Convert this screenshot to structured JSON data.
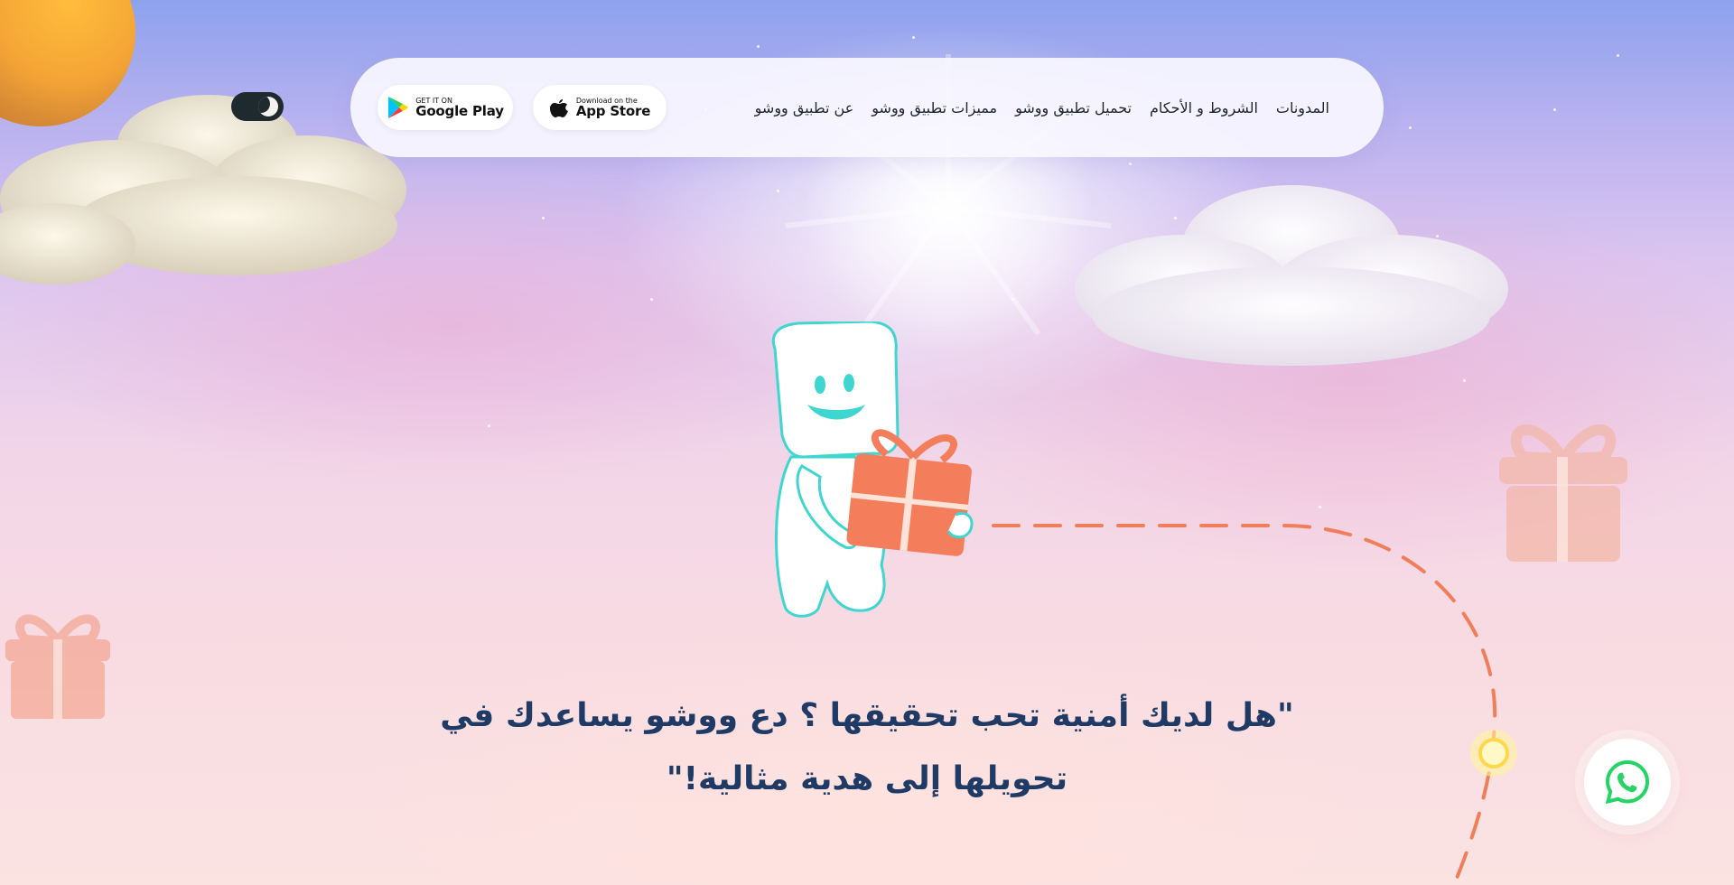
{
  "nav": {
    "links": [
      "عن تطبيق ووشو",
      "مميزات تطبيق ووشو",
      "تحميل تطبيق ووشو",
      "الشروط و الأحكام",
      "المدونات"
    ],
    "app_store": {
      "small": "Download on the",
      "big": "App Store"
    },
    "google_play": {
      "small": "GET IT ON",
      "big": "Google Play"
    }
  },
  "theme_toggle": {
    "icon": "moon-icon"
  },
  "hero": {
    "headline_line1": "\"هل لديك أمنية تحب تحقيقها ؟ دع ووشو يساعدك في",
    "headline_line2": "تحويلها إلى هدية مثالية!\""
  },
  "whatsapp": {
    "icon": "whatsapp-icon",
    "color": "#25d366"
  },
  "colors": {
    "headline": "#1f3a64",
    "gift": "#f47e5c",
    "mascot_outline": "#3fd6cf"
  }
}
